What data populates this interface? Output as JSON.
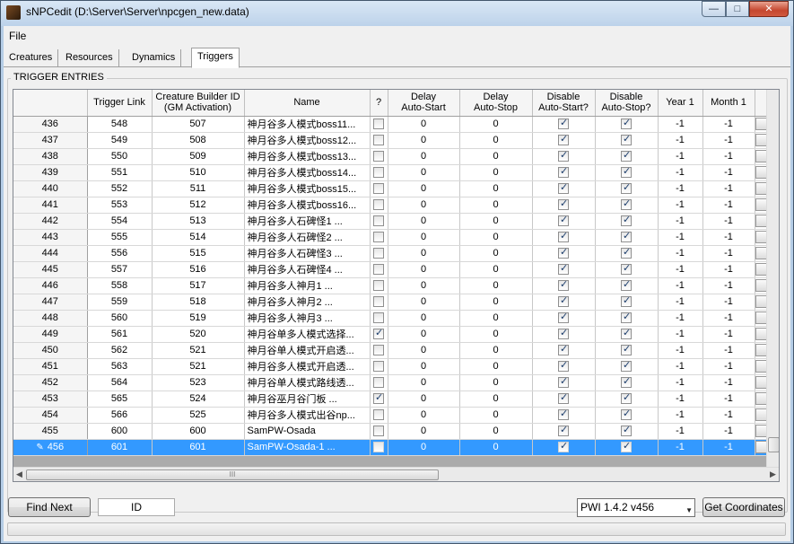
{
  "window": {
    "title": "sNPCedit (D:\\Server\\Server\\npcgen_new.data)",
    "minimize": "—",
    "maximize": "□",
    "close": "✕"
  },
  "menu": {
    "file": "File"
  },
  "tabs": [
    "Creatures",
    "Resources",
    "Dynamics",
    "Triggers"
  ],
  "active_tab": "Triggers",
  "group_label": "TRIGGER ENTRIES",
  "columns": [
    "Trigger Link",
    "Creature Builder ID (GM Activation)",
    "Name",
    "?",
    "Delay Auto-Start",
    "Delay Auto-Stop",
    "Disable Auto-Start?",
    "Disable Auto-Stop?",
    "Year 1",
    "Month 1"
  ],
  "column_headers": {
    "trigger_link": "Trigger Link",
    "builder_1": "Creature Builder ID",
    "builder_2": "(GM Activation)",
    "name": "Name",
    "q": "?",
    "das_1": "Delay",
    "das_2": "Auto-Start",
    "dast_1": "Delay",
    "dast_2": "Auto-Stop",
    "dis_start_1": "Disable",
    "dis_start_2": "Auto-Start?",
    "dis_stop_1": "Disable",
    "dis_stop_2": "Auto-Stop?",
    "year1": "Year 1",
    "month1": "Month 1"
  },
  "rows": [
    {
      "idx": "436",
      "link": "548",
      "builder": "507",
      "name": "神月谷多人模式boss11...",
      "q": false,
      "das": "0",
      "dast": "0",
      "ds": true,
      "dst": true,
      "year": "-1",
      "month": "-1"
    },
    {
      "idx": "437",
      "link": "549",
      "builder": "508",
      "name": "神月谷多人模式boss12...",
      "q": false,
      "das": "0",
      "dast": "0",
      "ds": true,
      "dst": true,
      "year": "-1",
      "month": "-1"
    },
    {
      "idx": "438",
      "link": "550",
      "builder": "509",
      "name": "神月谷多人模式boss13...",
      "q": false,
      "das": "0",
      "dast": "0",
      "ds": true,
      "dst": true,
      "year": "-1",
      "month": "-1"
    },
    {
      "idx": "439",
      "link": "551",
      "builder": "510",
      "name": "神月谷多人模式boss14...",
      "q": false,
      "das": "0",
      "dast": "0",
      "ds": true,
      "dst": true,
      "year": "-1",
      "month": "-1"
    },
    {
      "idx": "440",
      "link": "552",
      "builder": "511",
      "name": "神月谷多人模式boss15...",
      "q": false,
      "das": "0",
      "dast": "0",
      "ds": true,
      "dst": true,
      "year": "-1",
      "month": "-1"
    },
    {
      "idx": "441",
      "link": "553",
      "builder": "512",
      "name": "神月谷多人模式boss16...",
      "q": false,
      "das": "0",
      "dast": "0",
      "ds": true,
      "dst": true,
      "year": "-1",
      "month": "-1"
    },
    {
      "idx": "442",
      "link": "554",
      "builder": "513",
      "name": "神月谷多人石碑怪1 ...",
      "q": false,
      "das": "0",
      "dast": "0",
      "ds": true,
      "dst": true,
      "year": "-1",
      "month": "-1"
    },
    {
      "idx": "443",
      "link": "555",
      "builder": "514",
      "name": "神月谷多人石碑怪2 ...",
      "q": false,
      "das": "0",
      "dast": "0",
      "ds": true,
      "dst": true,
      "year": "-1",
      "month": "-1"
    },
    {
      "idx": "444",
      "link": "556",
      "builder": "515",
      "name": "神月谷多人石碑怪3 ...",
      "q": false,
      "das": "0",
      "dast": "0",
      "ds": true,
      "dst": true,
      "year": "-1",
      "month": "-1"
    },
    {
      "idx": "445",
      "link": "557",
      "builder": "516",
      "name": "神月谷多人石碑怪4 ...",
      "q": false,
      "das": "0",
      "dast": "0",
      "ds": true,
      "dst": true,
      "year": "-1",
      "month": "-1"
    },
    {
      "idx": "446",
      "link": "558",
      "builder": "517",
      "name": "神月谷多人神月1 ...",
      "q": false,
      "das": "0",
      "dast": "0",
      "ds": true,
      "dst": true,
      "year": "-1",
      "month": "-1"
    },
    {
      "idx": "447",
      "link": "559",
      "builder": "518",
      "name": "神月谷多人神月2 ...",
      "q": false,
      "das": "0",
      "dast": "0",
      "ds": true,
      "dst": true,
      "year": "-1",
      "month": "-1"
    },
    {
      "idx": "448",
      "link": "560",
      "builder": "519",
      "name": "神月谷多人神月3 ...",
      "q": false,
      "das": "0",
      "dast": "0",
      "ds": true,
      "dst": true,
      "year": "-1",
      "month": "-1"
    },
    {
      "idx": "449",
      "link": "561",
      "builder": "520",
      "name": "神月谷单多人模式选择...",
      "q": true,
      "das": "0",
      "dast": "0",
      "ds": true,
      "dst": true,
      "year": "-1",
      "month": "-1"
    },
    {
      "idx": "450",
      "link": "562",
      "builder": "521",
      "name": "神月谷单人模式开启透...",
      "q": false,
      "das": "0",
      "dast": "0",
      "ds": true,
      "dst": true,
      "year": "-1",
      "month": "-1"
    },
    {
      "idx": "451",
      "link": "563",
      "builder": "521",
      "name": "神月谷多人模式开启透...",
      "q": false,
      "das": "0",
      "dast": "0",
      "ds": true,
      "dst": true,
      "year": "-1",
      "month": "-1"
    },
    {
      "idx": "452",
      "link": "564",
      "builder": "523",
      "name": "神月谷单人模式路线透...",
      "q": false,
      "das": "0",
      "dast": "0",
      "ds": true,
      "dst": true,
      "year": "-1",
      "month": "-1"
    },
    {
      "idx": "453",
      "link": "565",
      "builder": "524",
      "name": "神月谷巫月谷门板 ...",
      "q": true,
      "das": "0",
      "dast": "0",
      "ds": true,
      "dst": true,
      "year": "-1",
      "month": "-1"
    },
    {
      "idx": "454",
      "link": "566",
      "builder": "525",
      "name": "神月谷多人模式出谷np...",
      "q": false,
      "das": "0",
      "dast": "0",
      "ds": true,
      "dst": true,
      "year": "-1",
      "month": "-1"
    },
    {
      "idx": "455",
      "link": "600",
      "builder": "600",
      "name": "SamPW-Osada",
      "q": false,
      "das": "0",
      "dast": "0",
      "ds": true,
      "dst": true,
      "year": "-1",
      "month": "-1"
    },
    {
      "idx": "456",
      "link": "601",
      "builder": "601",
      "name": "SamPW-Osada-1 ...",
      "q": false,
      "das": "0",
      "dast": "0",
      "ds": true,
      "dst": true,
      "year": "-1",
      "month": "-1",
      "selected": true
    }
  ],
  "hscroll_grip": "III",
  "buttons": {
    "find_next": "Find Next",
    "get_coordinates": "Get Coordinates"
  },
  "id_field": {
    "value": "ID"
  },
  "version_select": {
    "value": "PWI 1.4.2 v456"
  },
  "icons": {
    "pencil": "pencil-icon",
    "dropdown": "dropdown-arrow-icon"
  }
}
